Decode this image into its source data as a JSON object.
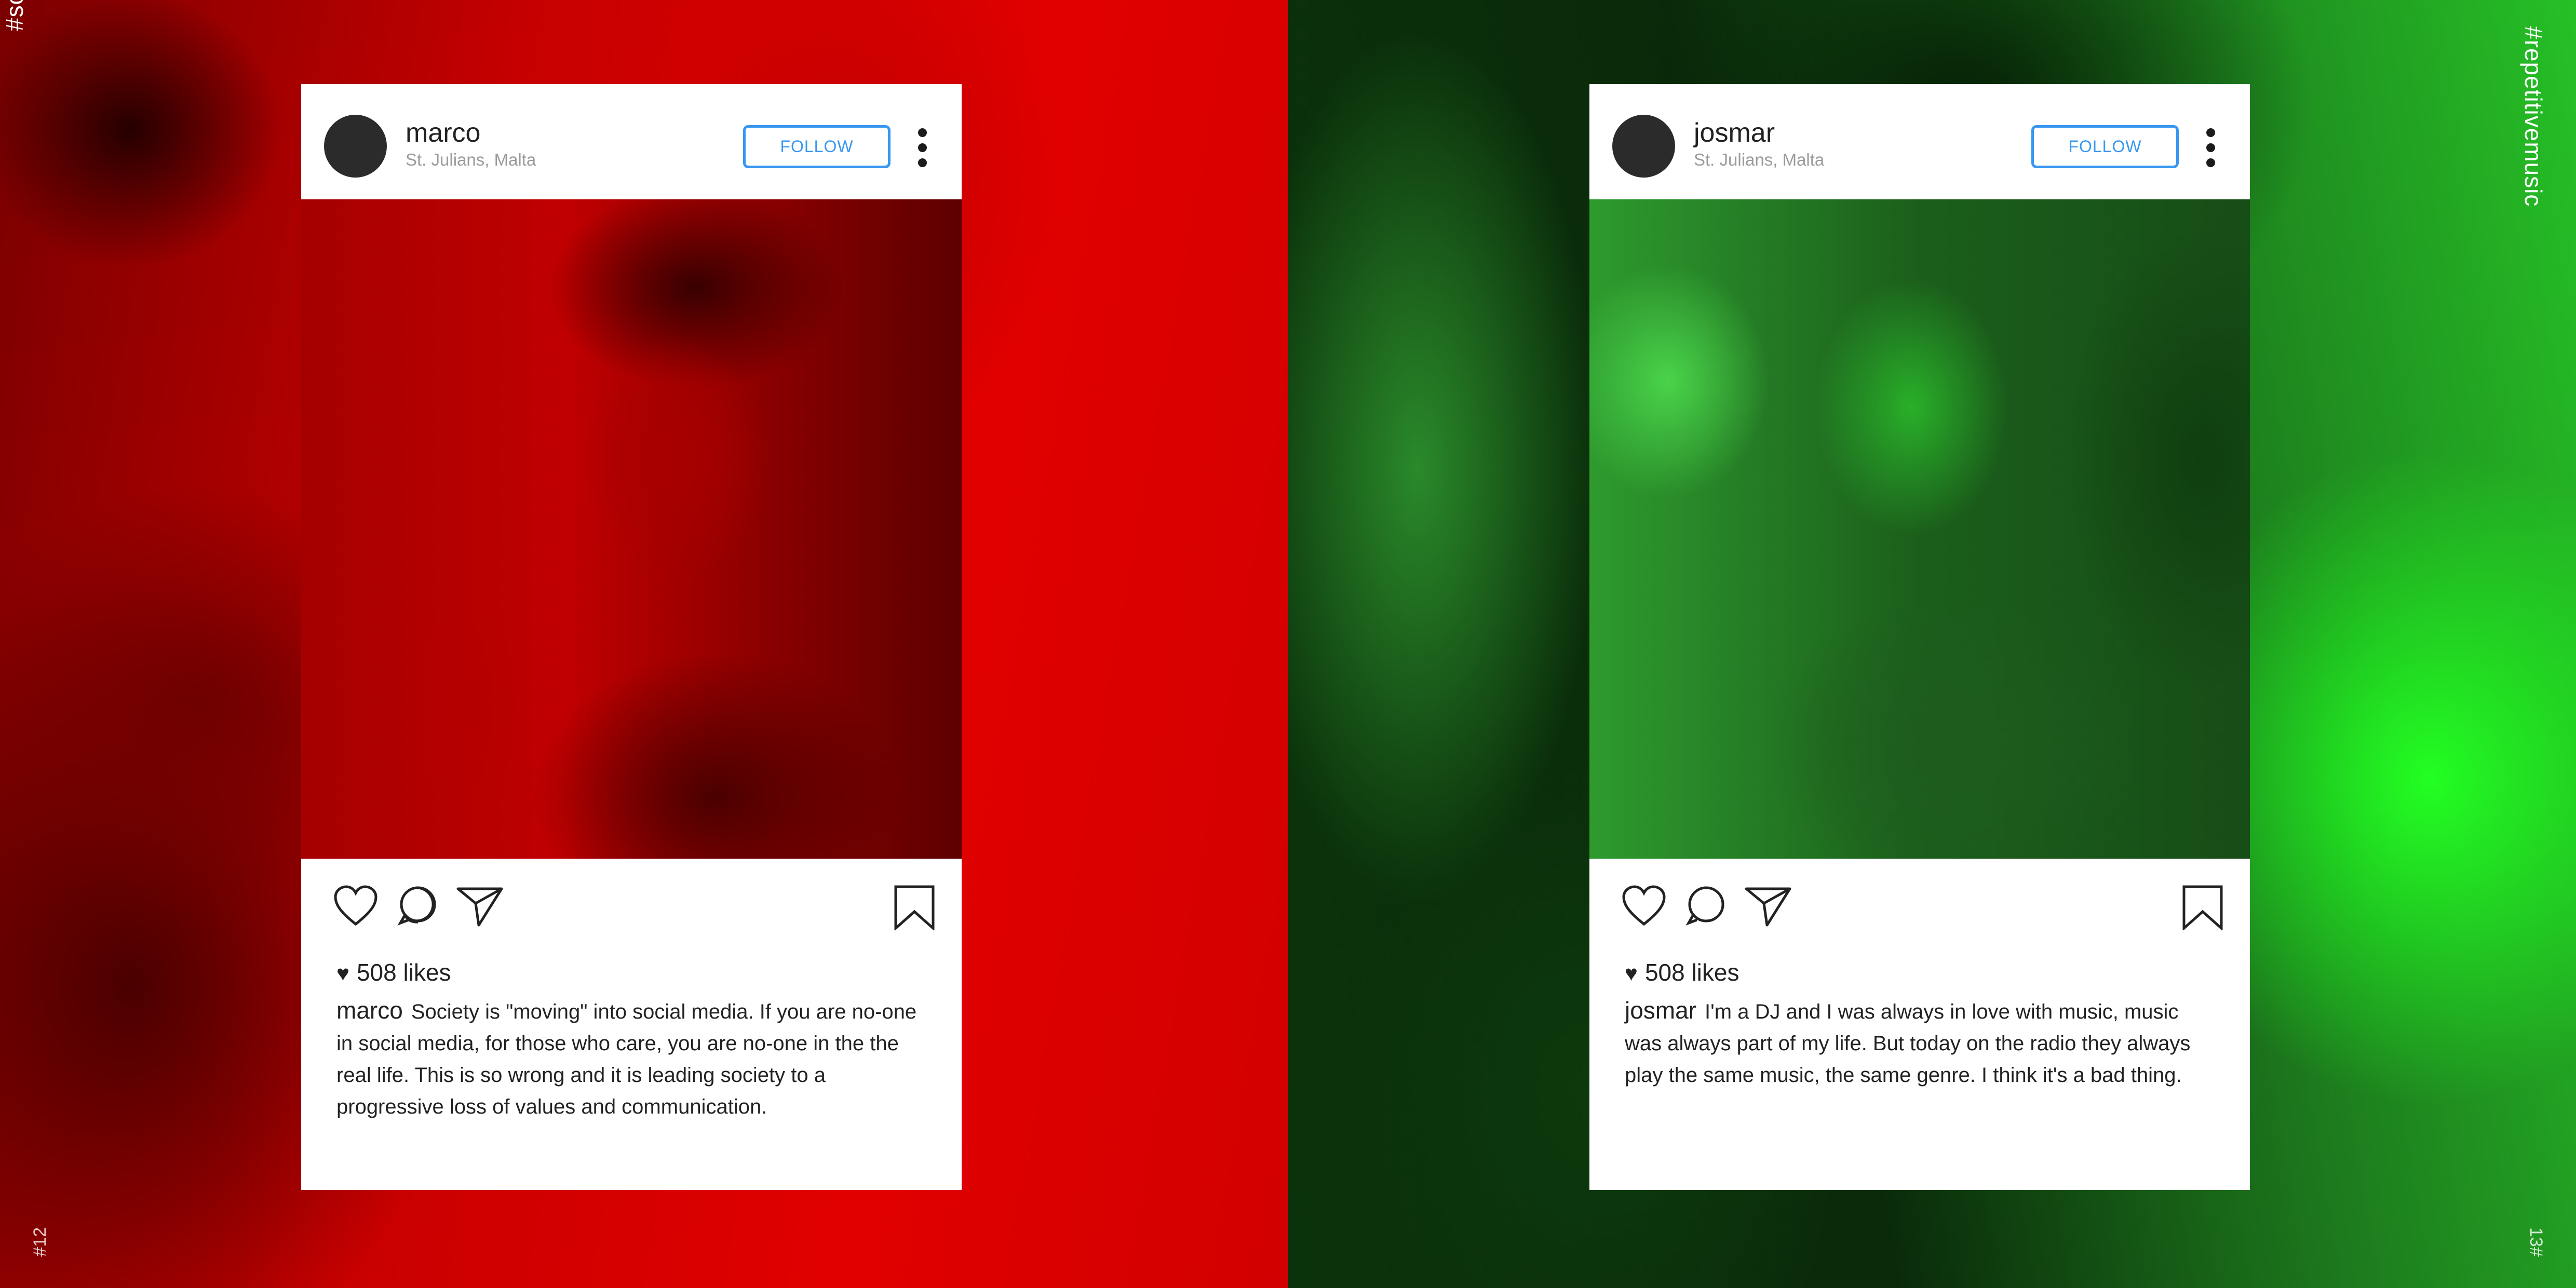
{
  "left_page": {
    "hashtag": "#socialmediasociety",
    "page_number": "#12",
    "post": {
      "username": "marco",
      "location": "St. Julians, Malta",
      "follow_label": "FOLLOW",
      "likes": "508 likes",
      "caption_user": "marco",
      "caption_text": "Society is \"moving\" into social media. If you are no-one in social media, for those who care, you are no-one in the the real life. This is so wrong and it is leading society to a progressive loss of values and communication."
    },
    "tint_color": "#d40000"
  },
  "right_page": {
    "hashtag": "#repetitivemusic",
    "page_number": "13#",
    "post": {
      "username": "josmar",
      "location": "St. Julians, Malta",
      "follow_label": "FOLLOW",
      "likes": "508 likes",
      "caption_user": "josmar",
      "caption_text": "I'm a DJ and I was always in love with music, music was always part of my life. But today on the radio they always play the same music, the same genre. I think it's a bad thing."
    },
    "tint_color": "#1fd11f"
  },
  "icons": [
    "heart-icon",
    "comment-icon",
    "share-icon",
    "bookmark-icon",
    "more-options-icon"
  ],
  "accent_color": "#3897f0"
}
